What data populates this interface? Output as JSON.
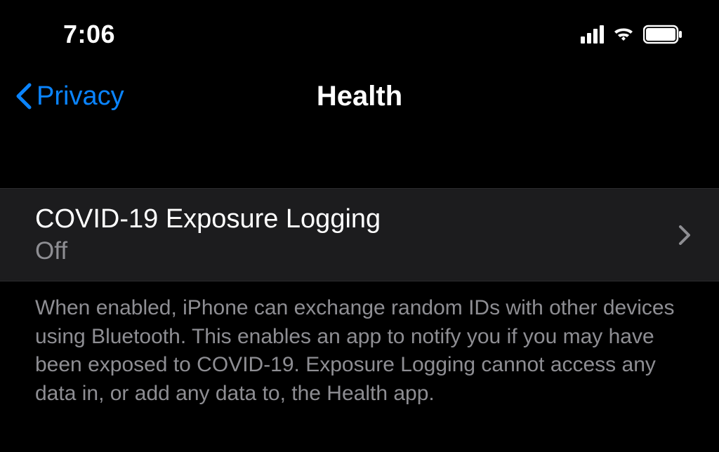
{
  "statusBar": {
    "time": "7:06"
  },
  "navBar": {
    "backLabel": "Privacy",
    "title": "Health"
  },
  "row": {
    "title": "COVID-19 Exposure Logging",
    "status": "Off"
  },
  "description": "When enabled, iPhone can exchange random IDs with other devices using Bluetooth. This enables an app to notify you if you may have been exposed to COVID-19. Exposure Logging cannot access any data in, or add any data to, the Health app."
}
